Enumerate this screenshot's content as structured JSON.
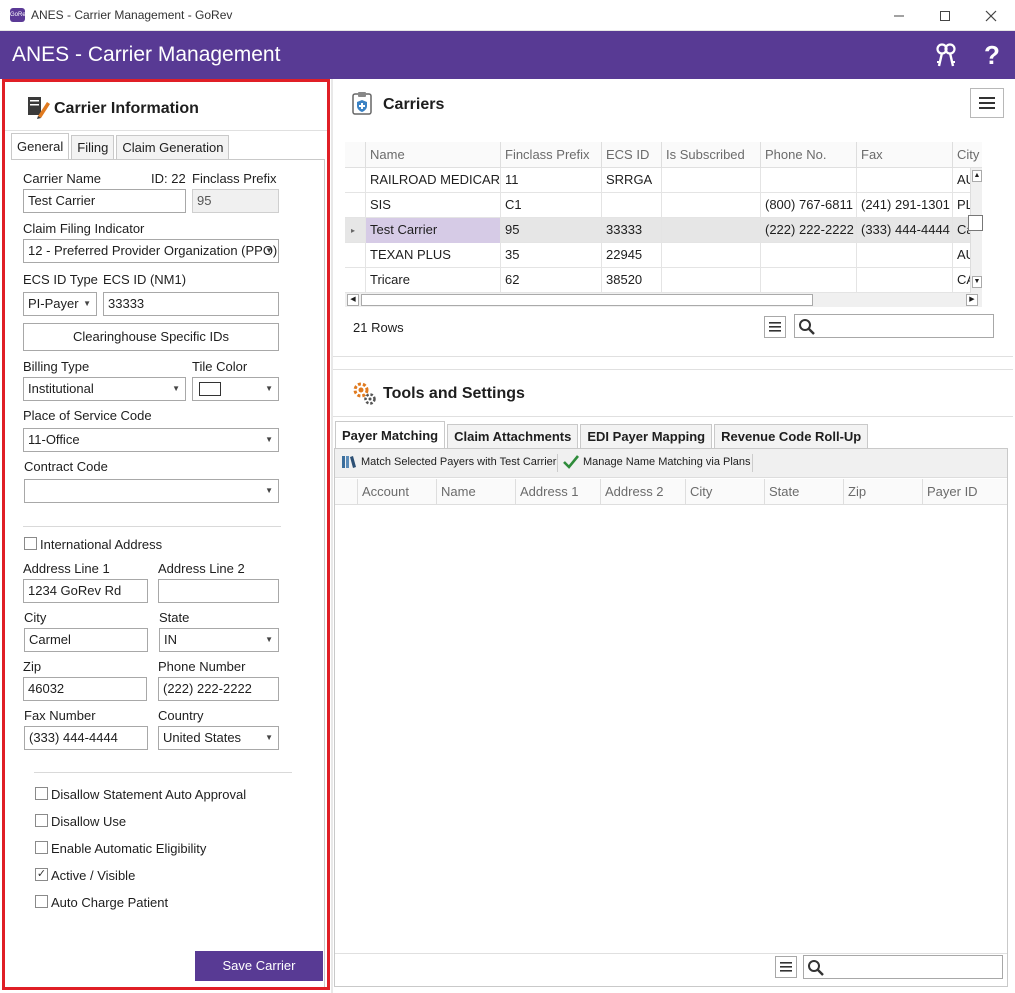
{
  "window": {
    "title": "ANES - Carrier Management - GoRev",
    "logo_text": "GoRev"
  },
  "header": {
    "title": "ANES - Carrier Management",
    "keys_icon": "keys-icon",
    "help_icon": "help-icon",
    "accent": "#583a94"
  },
  "carrier_info": {
    "heading": "Carrier Information",
    "tabs": [
      "General",
      "Filing",
      "Claim Generation"
    ],
    "carrier_name_label": "Carrier Name",
    "id_label": "ID: 22",
    "carrier_name_value": "Test Carrier",
    "finclass_prefix_label": "Finclass Prefix",
    "finclass_prefix_value": "95",
    "claim_filing_label": "Claim Filing Indicator",
    "claim_filing_value": "12 - Preferred Provider Organization (PPO)",
    "ecs_id_type_label": "ECS ID Type",
    "ecs_id_label": "ECS ID (NM1)",
    "ecs_id_type_value": "PI-Payer",
    "ecs_id_value": "33333",
    "clearinghouse_button": "Clearinghouse Specific IDs",
    "billing_type_label": "Billing Type",
    "billing_type_value": "Institutional",
    "tile_color_label": "Tile Color",
    "place_of_service_label": "Place of Service Code",
    "place_of_service_value": "11-Office",
    "contract_code_label": "Contract Code",
    "contract_code_value": "",
    "international_label": "International Address",
    "address1_label": "Address Line 1",
    "address1_value": "1234 GoRev Rd",
    "address2_label": "Address Line 2",
    "address2_value": "",
    "city_label": "City",
    "city_value": "Carmel",
    "state_label": "State",
    "state_value": "IN",
    "zip_label": "Zip",
    "zip_value": "46032",
    "phone_label": "Phone Number",
    "phone_value": "(222) 222-2222",
    "fax_label": "Fax Number",
    "fax_value": "(333) 444-4444",
    "country_label": "Country",
    "country_value": "United States",
    "options": [
      {
        "label": "Disallow Statement Auto Approval",
        "checked": false
      },
      {
        "label": "Disallow Use",
        "checked": false
      },
      {
        "label": "Enable Automatic Eligibility",
        "checked": false
      },
      {
        "label": "Active / Visible",
        "checked": true
      },
      {
        "label": "Auto Charge Patient",
        "checked": false
      }
    ],
    "save_button": "Save Carrier"
  },
  "carriers": {
    "heading": "Carriers",
    "columns": [
      "Name",
      "Finclass Prefix",
      "ECS ID",
      "Is Subscribed",
      "Phone No.",
      "Fax",
      "City"
    ],
    "rows": [
      [
        "RAILROAD MEDICARE",
        "11",
        "SRRGA",
        "",
        "",
        "",
        "AUG"
      ],
      [
        "SIS",
        "C1",
        "",
        "",
        "(800) 767-6811",
        "(241) 291-1301",
        "PLAI"
      ],
      [
        "Test Carrier",
        "95",
        "33333",
        "",
        "(222) 222-2222",
        "(333) 444-4444",
        "Carr"
      ],
      [
        "TEXAN PLUS",
        "35",
        "22945",
        "",
        "",
        "",
        "AUS"
      ],
      [
        "Tricare",
        "62",
        "38520",
        "",
        "",
        "",
        "CAM"
      ]
    ],
    "selected_row": 2,
    "row_count": "21 Rows",
    "search_value": ""
  },
  "tools": {
    "heading": "Tools and Settings",
    "tabs": [
      "Payer Matching",
      "Claim Attachments",
      "EDI Payer Mapping",
      "Revenue Code Roll-Up"
    ],
    "toolbar": {
      "match_label": "Match Selected Payers with Test Carrier",
      "manage_label": "Manage Name Matching via Plans"
    },
    "columns": [
      "Account",
      "Name",
      "Address 1",
      "Address 2",
      "City",
      "State",
      "Zip",
      "Payer ID"
    ],
    "search_value": ""
  }
}
